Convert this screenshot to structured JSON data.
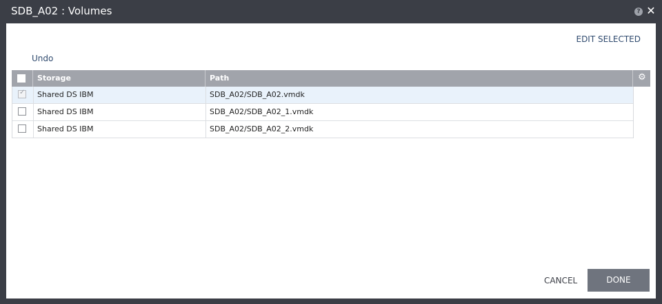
{
  "window": {
    "title": "SDB_A02 : Volumes",
    "help_icon": "help-icon",
    "help_glyph": "?",
    "close_icon": "close-icon",
    "close_glyph": "✕"
  },
  "toolbar": {
    "edit_selected": "EDIT SELECTED",
    "undo": "Undo"
  },
  "grid": {
    "columns": [
      "Storage",
      "Path"
    ],
    "settings_icon": "gear-icon",
    "settings_glyph": "⚙",
    "header_checked": false,
    "rows": [
      {
        "checked": true,
        "storage": "Shared DS IBM",
        "path": "SDB_A02/SDB_A02.vmdk"
      },
      {
        "checked": false,
        "storage": "Shared DS IBM",
        "path": "SDB_A02/SDB_A02_1.vmdk"
      },
      {
        "checked": false,
        "storage": "Shared DS IBM",
        "path": "SDB_A02/SDB_A02_2.vmdk"
      }
    ]
  },
  "footer": {
    "cancel": "CANCEL",
    "done": "DONE"
  },
  "colors": {
    "titlebar": "#3b3e46",
    "header": "#a1a4ab",
    "selected_row": "#e9f2fb",
    "done_button": "#6f747e",
    "link": "#2f4a6e"
  }
}
